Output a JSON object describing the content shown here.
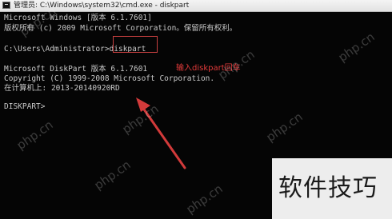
{
  "window": {
    "title": "管理员: C:\\Windows\\system32\\cmd.exe - diskpart"
  },
  "console": {
    "lines": [
      "Microsoft Windows [版本 6.1.7601]",
      "版权所有 (c) 2009 Microsoft Corporation。保留所有权利。",
      "",
      "C:\\Users\\Administrator>diskpart",
      "",
      "Microsoft DiskPart 版本 6.1.7601",
      "Copyright (C) 1999-2008 Microsoft Corporation.",
      "在计算机上: 2013-20140920RD",
      "",
      "DISKPART>"
    ]
  },
  "annotation": {
    "text": "输入diskpart回车",
    "color": "#e23a3a"
  },
  "watermark": {
    "text": "php.cn"
  },
  "brand": {
    "text": "软件技巧"
  }
}
